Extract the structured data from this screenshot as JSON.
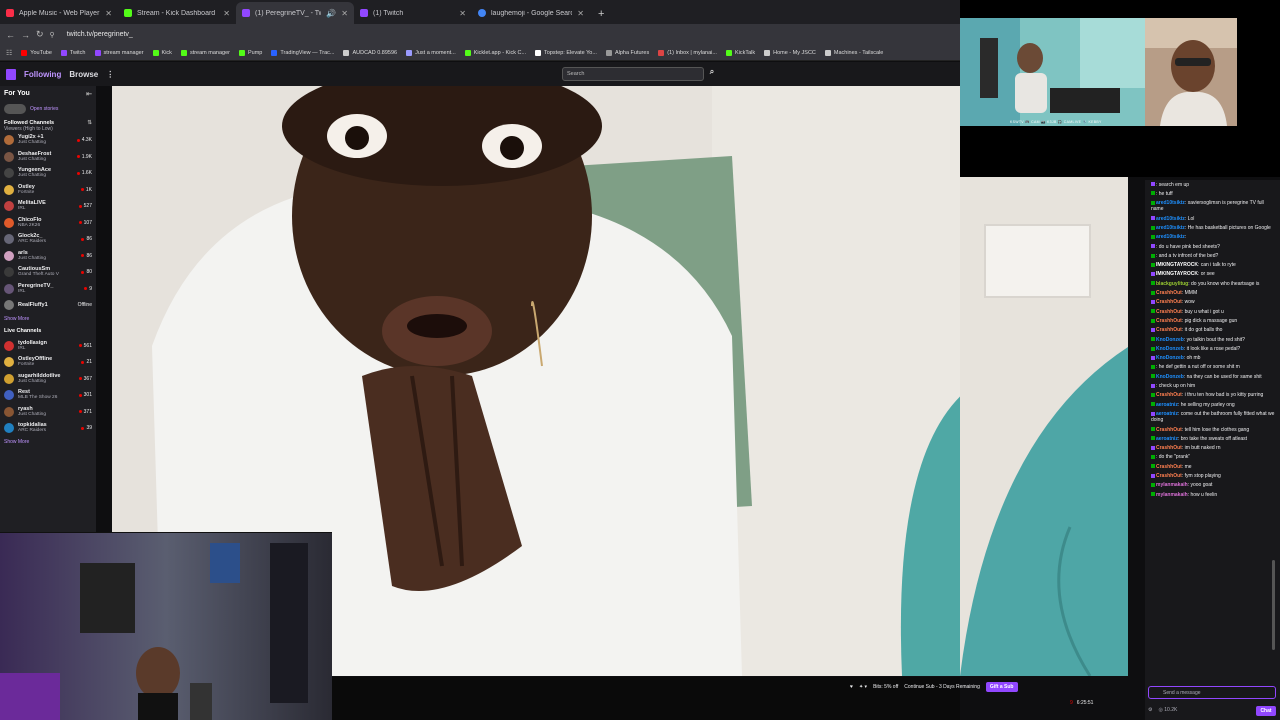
{
  "browser": {
    "tabs": [
      {
        "label": "Apple Music - Web Player",
        "color": "#fa2d48"
      },
      {
        "label": "Stream - Kick Dashboard",
        "color": "#53fc18"
      },
      {
        "label": "(1) PeregrineTV_ - Twitch",
        "color": "#9147ff",
        "active": true
      },
      {
        "label": "(1) Twitch",
        "color": "#9147ff"
      },
      {
        "label": "laughemoji - Google Search",
        "color": "#4285f4"
      }
    ],
    "new_tab": "+",
    "url": "twitch.tv/peregrinetv_",
    "bookmarks": [
      {
        "label": "YouTube",
        "color": "#ff0000"
      },
      {
        "label": "Twitch",
        "color": "#9147ff"
      },
      {
        "label": "stream manager",
        "color": "#9147ff"
      },
      {
        "label": "Kick",
        "color": "#53fc18"
      },
      {
        "label": "stream manager",
        "color": "#53fc18"
      },
      {
        "label": "Pump",
        "color": "#53fc18"
      },
      {
        "label": "TradingView — Trac...",
        "color": "#2962ff"
      },
      {
        "label": "AUDCAD 0.89596",
        "color": "#cccccc"
      },
      {
        "label": "Just a moment...",
        "color": "#9b9bff"
      },
      {
        "label": "Kicklet.app - Kick C...",
        "color": "#53fc18"
      },
      {
        "label": "Topstep: Elevate Yo...",
        "color": "#ffffff"
      },
      {
        "label": "Alpha Futures",
        "color": "#999999"
      },
      {
        "label": "(1) Inbox | mylanai...",
        "color": "#d44"
      },
      {
        "label": "KickTalk",
        "color": "#53fc18"
      },
      {
        "label": "Home - My JSCC",
        "color": "#cccccc"
      },
      {
        "label": "Machines - Tailscale",
        "color": "#cccccc"
      }
    ]
  },
  "header": {
    "following": "Following",
    "browse": "Browse",
    "more": "⋮",
    "search_placeholder": "Search"
  },
  "sidebar": {
    "for_you": "For You",
    "open_stories": "Open stories",
    "followed_title": "Followed Channels",
    "followed_sort": "Viewers (High to Low)",
    "followed": [
      {
        "name": "Yugi2x +1",
        "cat": "Just Chatting",
        "viewers": "4.3K",
        "color": "#b06b3a"
      },
      {
        "name": "DeshaeFrost",
        "cat": "Just Chatting",
        "viewers": "1.9K",
        "color": "#7a5544"
      },
      {
        "name": "YungeenAce",
        "cat": "Just Chatting",
        "viewers": "1.6K",
        "color": "#444"
      },
      {
        "name": "Ostley",
        "cat": "Fortnite",
        "viewers": "1K",
        "color": "#e0b040"
      },
      {
        "name": "MelitaLIVE",
        "cat": "IRL",
        "viewers": "527",
        "color": "#c04040"
      },
      {
        "name": "ChicoFlo",
        "cat": "NBA 2K26",
        "viewers": "107",
        "color": "#e05a2a"
      },
      {
        "name": "Glock2c_",
        "cat": "ARC Raiders",
        "viewers": "86",
        "color": "#667"
      },
      {
        "name": "arls",
        "cat": "Just Chatting",
        "viewers": "86",
        "color": "#d0a0c0"
      },
      {
        "name": "CautiousSm",
        "cat": "Grand Theft Auto V",
        "viewers": "80",
        "color": "#3a3a3a"
      },
      {
        "name": "PeregrineTV_",
        "cat": "IRL",
        "viewers": "9",
        "color": "#665577"
      },
      {
        "name": "RealFluffy1",
        "cat": "",
        "viewers": "Offline",
        "color": "#777"
      }
    ],
    "show_more": "Show More",
    "live_title": "Live Channels",
    "live": [
      {
        "name": "tydollasign",
        "cat": "IRL",
        "viewers": "561",
        "color": "#d03030"
      },
      {
        "name": "OstleyOffline",
        "cat": "Fortnite",
        "viewers": "21",
        "color": "#e0b040"
      },
      {
        "name": "sugarhilddotlive",
        "cat": "Just Chatting",
        "viewers": "367",
        "color": "#d0a030"
      },
      {
        "name": "Rest",
        "cat": "MLB The Show 26",
        "viewers": "301",
        "color": "#4060c0"
      },
      {
        "name": "ryash",
        "cat": "Just Chatting",
        "viewers": "371",
        "color": "#885533"
      },
      {
        "name": "topkidalias",
        "cat": "ARC Raiders",
        "viewers": "39",
        "color": "#2080c0"
      }
    ],
    "show_more_2": "Show More"
  },
  "overlay": {
    "cam_text": "KSWTV  🎮 CAM  📷 K3JB  🎧 CAMLIVE  🎙️ KEBBY"
  },
  "chat": {
    "messages": [
      {
        "user": "",
        "text": "search em up",
        "color": "#ff4500"
      },
      {
        "user": "",
        "text": "he tuff",
        "color": "#ff4500"
      },
      {
        "user": "ared10tsiktz",
        "text": "xaviersoglimsn is peregrine TV full name",
        "color": "#1e90ff"
      },
      {
        "user": "ared10tsiktz",
        "text": "Lol",
        "color": "#1e90ff"
      },
      {
        "user": "ared10tsiktz",
        "text": "He has basketball pictures on Google",
        "color": "#1e90ff"
      },
      {
        "user": "ared10tsiktz",
        "text": "",
        "color": "#1e90ff"
      },
      {
        "user": "",
        "text": "do u have pink bed sheets?",
        "color": "#ff4500"
      },
      {
        "user": "",
        "text": "and a tv infront of the bed?",
        "color": "#ff4500"
      },
      {
        "user": "IMKINGTAYROCK",
        "text": "can i talk to ryte",
        "color": "#ffffff"
      },
      {
        "user": "IMKINGTAYROCK",
        "text": "or see",
        "color": "#ffffff"
      },
      {
        "user": "blackguylitug",
        "text": "do you know who iheartsage is",
        "color": "#9acd32"
      },
      {
        "user": "CrashhOut",
        "text": "MMM",
        "color": "#ff7f50"
      },
      {
        "user": "CrashhOut",
        "text": "wow",
        "color": "#ff7f50"
      },
      {
        "user": "CrashhOut",
        "text": "buy u what i got u",
        "color": "#ff7f50"
      },
      {
        "user": "CrashhOut",
        "text": "pig dick a massage gun",
        "color": "#ff7f50"
      },
      {
        "user": "CrashhOut",
        "text": "it do got balls tho",
        "color": "#ff7f50"
      },
      {
        "user": "KnoDonzeb",
        "text": "yo talkin bout the red shit?",
        "color": "#1e90ff"
      },
      {
        "user": "KnoDonzeb",
        "text": "it look like a rose pedal?",
        "color": "#1e90ff"
      },
      {
        "user": "KnoDonzeb",
        "text": "oh mb",
        "color": "#1e90ff"
      },
      {
        "user": "",
        "text": "he def gettin a nut off or some shit m",
        "color": "#ff4500"
      },
      {
        "user": "KnoDonzeb",
        "text": "na they can be used for same shit",
        "color": "#1e90ff"
      },
      {
        "user": "",
        "text": "check up on him",
        "color": "#ff4500"
      },
      {
        "user": "CrashhOut",
        "text": "i thru ten how bad is yo kitty purring",
        "color": "#ff7f50"
      },
      {
        "user": "aeroatniz",
        "text": "he selling my parley ong",
        "color": "#1e90ff"
      },
      {
        "user": "aeroatniz",
        "text": "come out the bathroom fully fitted what we doing",
        "color": "#1e90ff"
      },
      {
        "user": "CrashhOut",
        "text": "tell him lose the clothes gang",
        "color": "#ff7f50"
      },
      {
        "user": "aeroatniz",
        "text": "bro take the sweats off atleast",
        "color": "#1e90ff"
      },
      {
        "user": "CrashhOut",
        "text": "im butt naked rn",
        "color": "#ff7f50"
      },
      {
        "user": "",
        "text": "do the \"prank\"",
        "color": "#ff4500"
      },
      {
        "user": "CrashhOut",
        "text": "me",
        "color": "#ff7f50"
      },
      {
        "user": "CrashhOut",
        "text": "fym stop playing",
        "color": "#ff7f50"
      },
      {
        "user": "mylanmakaih",
        "text": "yooo goat",
        "color": "#da70d6"
      },
      {
        "user": "mylanmakaih",
        "text": "how u feelin",
        "color": "#da70d6"
      }
    ],
    "input_placeholder": "Send a message",
    "points": "10.2K",
    "chat_button": "Chat"
  },
  "player": {
    "bits": "Bits: 5% off",
    "continue_sub": "Continue Sub - 3 Days Remaining",
    "gift": "Gift a Sub",
    "viewers": "9",
    "uptime": "6:25:51"
  }
}
